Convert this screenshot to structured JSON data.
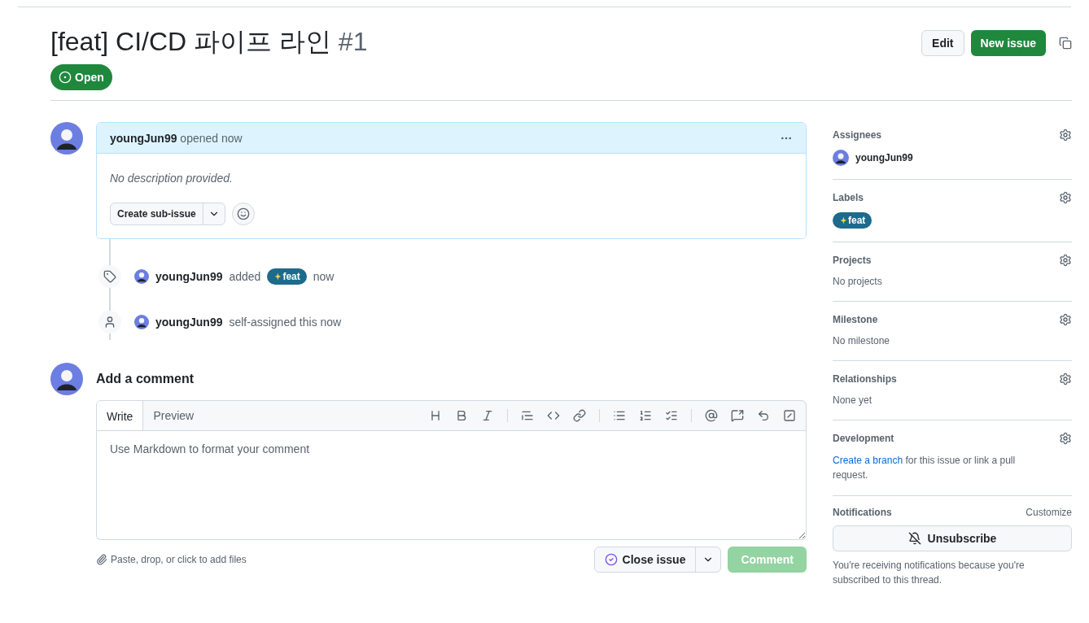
{
  "header": {
    "title": "[feat] CI/CD 파이프 라인",
    "number": "#1",
    "state": {
      "kind": "open",
      "label": "Open"
    },
    "buttons": [
      "Edit",
      "New issue"
    ]
  },
  "body": {
    "author": "youngJun99",
    "action": "opened now",
    "description": "No description provided.",
    "sub_issue_button": "Create sub-issue"
  },
  "events": [
    {
      "kind": "label",
      "user": "youngJun99",
      "verb": "added",
      "label": {
        "name": "feat",
        "color": "#1d6a8c"
      },
      "time": "now"
    },
    {
      "kind": "assign",
      "user": "youngJun99",
      "verb": "self-assigned this now"
    }
  ],
  "comment": {
    "heading": "Add a comment",
    "tabs": [
      {
        "label": "Write",
        "selected": true
      },
      {
        "label": "Preview",
        "selected": false
      }
    ],
    "placeholder": "Use Markdown to format your comment",
    "attach_hint": "Paste, drop, or click to add files",
    "close_button": "Close issue",
    "submit_button": {
      "label": "Comment",
      "disabled": true
    }
  },
  "sidebar": [
    {
      "kind": "user",
      "title": "Assignees",
      "user": "youngJun99"
    },
    {
      "kind": "labels",
      "title": "Labels",
      "labels": [
        {
          "name": "feat",
          "color": "#1d6a8c"
        }
      ]
    },
    {
      "kind": "text",
      "title": "Projects",
      "text": "No projects"
    },
    {
      "kind": "text",
      "title": "Milestone",
      "text": "No milestone"
    },
    {
      "kind": "text",
      "title": "Relationships",
      "text": "None yet"
    },
    {
      "kind": "link",
      "title": "Development",
      "link": "Create a branch",
      "text": "for this issue or link a pull request."
    }
  ],
  "notifications": {
    "title": "Notifications",
    "customize": "Customize",
    "button": "Unsubscribe",
    "note": "You're receiving notifications because you're subscribed to this thread."
  }
}
